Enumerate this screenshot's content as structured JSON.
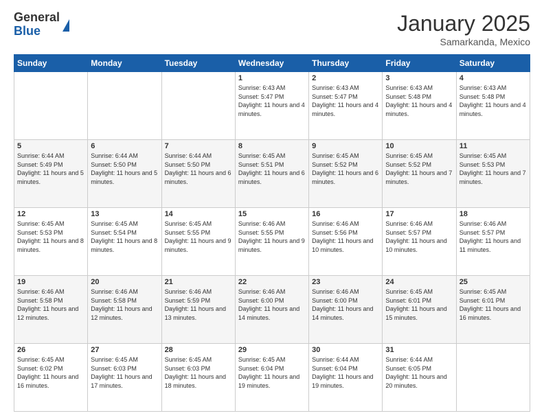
{
  "logo": {
    "general": "General",
    "blue": "Blue"
  },
  "header": {
    "month": "January 2025",
    "location": "Samarkanda, Mexico"
  },
  "weekdays": [
    "Sunday",
    "Monday",
    "Tuesday",
    "Wednesday",
    "Thursday",
    "Friday",
    "Saturday"
  ],
  "weeks": [
    [
      {
        "day": "",
        "info": ""
      },
      {
        "day": "",
        "info": ""
      },
      {
        "day": "",
        "info": ""
      },
      {
        "day": "1",
        "info": "Sunrise: 6:43 AM\nSunset: 5:47 PM\nDaylight: 11 hours and 4 minutes."
      },
      {
        "day": "2",
        "info": "Sunrise: 6:43 AM\nSunset: 5:47 PM\nDaylight: 11 hours and 4 minutes."
      },
      {
        "day": "3",
        "info": "Sunrise: 6:43 AM\nSunset: 5:48 PM\nDaylight: 11 hours and 4 minutes."
      },
      {
        "day": "4",
        "info": "Sunrise: 6:43 AM\nSunset: 5:48 PM\nDaylight: 11 hours and 4 minutes."
      }
    ],
    [
      {
        "day": "5",
        "info": "Sunrise: 6:44 AM\nSunset: 5:49 PM\nDaylight: 11 hours and 5 minutes."
      },
      {
        "day": "6",
        "info": "Sunrise: 6:44 AM\nSunset: 5:50 PM\nDaylight: 11 hours and 5 minutes."
      },
      {
        "day": "7",
        "info": "Sunrise: 6:44 AM\nSunset: 5:50 PM\nDaylight: 11 hours and 6 minutes."
      },
      {
        "day": "8",
        "info": "Sunrise: 6:45 AM\nSunset: 5:51 PM\nDaylight: 11 hours and 6 minutes."
      },
      {
        "day": "9",
        "info": "Sunrise: 6:45 AM\nSunset: 5:52 PM\nDaylight: 11 hours and 6 minutes."
      },
      {
        "day": "10",
        "info": "Sunrise: 6:45 AM\nSunset: 5:52 PM\nDaylight: 11 hours and 7 minutes."
      },
      {
        "day": "11",
        "info": "Sunrise: 6:45 AM\nSunset: 5:53 PM\nDaylight: 11 hours and 7 minutes."
      }
    ],
    [
      {
        "day": "12",
        "info": "Sunrise: 6:45 AM\nSunset: 5:53 PM\nDaylight: 11 hours and 8 minutes."
      },
      {
        "day": "13",
        "info": "Sunrise: 6:45 AM\nSunset: 5:54 PM\nDaylight: 11 hours and 8 minutes."
      },
      {
        "day": "14",
        "info": "Sunrise: 6:45 AM\nSunset: 5:55 PM\nDaylight: 11 hours and 9 minutes."
      },
      {
        "day": "15",
        "info": "Sunrise: 6:46 AM\nSunset: 5:55 PM\nDaylight: 11 hours and 9 minutes."
      },
      {
        "day": "16",
        "info": "Sunrise: 6:46 AM\nSunset: 5:56 PM\nDaylight: 11 hours and 10 minutes."
      },
      {
        "day": "17",
        "info": "Sunrise: 6:46 AM\nSunset: 5:57 PM\nDaylight: 11 hours and 10 minutes."
      },
      {
        "day": "18",
        "info": "Sunrise: 6:46 AM\nSunset: 5:57 PM\nDaylight: 11 hours and 11 minutes."
      }
    ],
    [
      {
        "day": "19",
        "info": "Sunrise: 6:46 AM\nSunset: 5:58 PM\nDaylight: 11 hours and 12 minutes."
      },
      {
        "day": "20",
        "info": "Sunrise: 6:46 AM\nSunset: 5:58 PM\nDaylight: 11 hours and 12 minutes."
      },
      {
        "day": "21",
        "info": "Sunrise: 6:46 AM\nSunset: 5:59 PM\nDaylight: 11 hours and 13 minutes."
      },
      {
        "day": "22",
        "info": "Sunrise: 6:46 AM\nSunset: 6:00 PM\nDaylight: 11 hours and 14 minutes."
      },
      {
        "day": "23",
        "info": "Sunrise: 6:46 AM\nSunset: 6:00 PM\nDaylight: 11 hours and 14 minutes."
      },
      {
        "day": "24",
        "info": "Sunrise: 6:45 AM\nSunset: 6:01 PM\nDaylight: 11 hours and 15 minutes."
      },
      {
        "day": "25",
        "info": "Sunrise: 6:45 AM\nSunset: 6:01 PM\nDaylight: 11 hours and 16 minutes."
      }
    ],
    [
      {
        "day": "26",
        "info": "Sunrise: 6:45 AM\nSunset: 6:02 PM\nDaylight: 11 hours and 16 minutes."
      },
      {
        "day": "27",
        "info": "Sunrise: 6:45 AM\nSunset: 6:03 PM\nDaylight: 11 hours and 17 minutes."
      },
      {
        "day": "28",
        "info": "Sunrise: 6:45 AM\nSunset: 6:03 PM\nDaylight: 11 hours and 18 minutes."
      },
      {
        "day": "29",
        "info": "Sunrise: 6:45 AM\nSunset: 6:04 PM\nDaylight: 11 hours and 19 minutes."
      },
      {
        "day": "30",
        "info": "Sunrise: 6:44 AM\nSunset: 6:04 PM\nDaylight: 11 hours and 19 minutes."
      },
      {
        "day": "31",
        "info": "Sunrise: 6:44 AM\nSunset: 6:05 PM\nDaylight: 11 hours and 20 minutes."
      },
      {
        "day": "",
        "info": ""
      }
    ]
  ]
}
